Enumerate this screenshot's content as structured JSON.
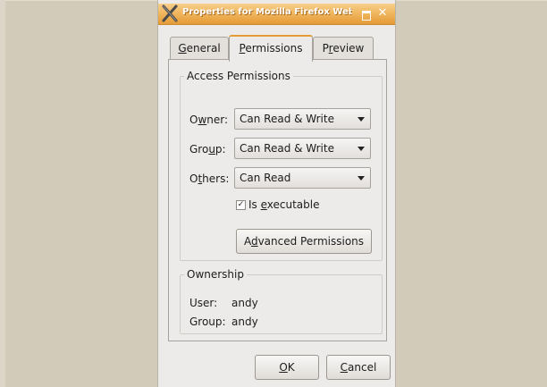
{
  "window": {
    "title": "Properties for Mozilla Firefox Web Browser",
    "icon": "x-window-icon",
    "controls": [
      "maximize-icon",
      "close-icon"
    ]
  },
  "tabs": [
    {
      "label": "General",
      "mnemonic": "G",
      "rest": "eneral",
      "active": false
    },
    {
      "label": "Permissions",
      "mnemonic": "P",
      "rest": "ermissions",
      "active": true
    },
    {
      "label": "Preview",
      "pre": "P",
      "mnemonic": "r",
      "rest": "eview",
      "active": false
    }
  ],
  "access": {
    "legend": "Access Permissions",
    "owner": {
      "pre": "O",
      "mnemonic": "w",
      "rest": "ner:",
      "value": "Can Read & Write"
    },
    "group": {
      "pre": "Gro",
      "mnemonic": "u",
      "rest": "p:",
      "value": "Can Read & Write"
    },
    "others": {
      "pre": "O",
      "mnemonic": "t",
      "rest": "hers:",
      "value": "Can Read"
    },
    "executable": {
      "checked": true,
      "pre": "Is ",
      "mnemonic": "e",
      "rest": "xecutable"
    },
    "advanced": {
      "pre": "A",
      "mnemonic": "d",
      "rest": "vanced Permissions"
    }
  },
  "ownership": {
    "legend": "Ownership",
    "user_label": "User:",
    "user_value": "andy",
    "group_label": "Group:",
    "group_value": "andy"
  },
  "buttons": {
    "ok": {
      "mnemonic": "O",
      "rest": "K"
    },
    "cancel": {
      "mnemonic": "C",
      "rest": "ancel"
    }
  },
  "colors": {
    "titlebar": "#e59b36",
    "dialog_bg": "#ecebea",
    "desktop_bg": "#d3cbb9"
  }
}
